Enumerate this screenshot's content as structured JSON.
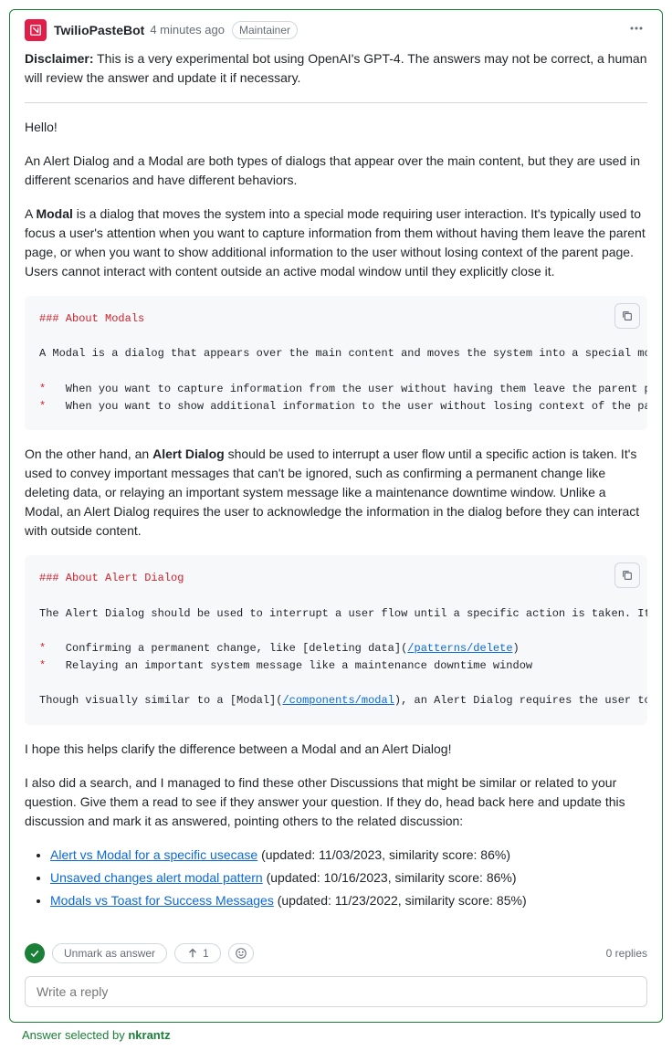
{
  "header": {
    "author": "TwilioPasteBot",
    "timestamp": "4 minutes ago",
    "badge": "Maintainer"
  },
  "body": {
    "disclaimer_label": "Disclaimer:",
    "disclaimer_text": " This is a very experimental bot using OpenAI's GPT-4. The answers may not be correct, a human will review the answer and update it if necessary.",
    "hello": "Hello!",
    "intro": "An Alert Dialog and a Modal are both types of dialogs that appear over the main content, but they are used in different scenarios and have different behaviors.",
    "modal_para_prefix": "A ",
    "modal_bold": "Modal",
    "modal_para_rest": " is a dialog that moves the system into a special mode requiring user interaction. It's typically used to focus a user's attention when you want to capture information from them without having them leave the parent page, or when you want to show additional information to the user without losing context of the parent page. Users cannot interact with content outside an active modal window until they explicitly close it.",
    "alert_para_prefix": "On the other hand, an ",
    "alert_bold": "Alert Dialog",
    "alert_para_rest": " should be used to interrupt a user flow until a specific action is taken. It's used to convey important messages that can't be ignored, such as confirming a permanent change like deleting data, or relaying an important system message like a maintenance downtime window. Unlike a Modal, an Alert Dialog requires the user to acknowledge the information in the dialog before they can interact with outside content.",
    "closing1": "I hope this helps clarify the difference between a Modal and an Alert Dialog!",
    "closing2": "I also did a search, and I managed to find these other Discussions that might be similar or related to your question. Give them a read to see if they answer your question. If they do, head back here and update this discussion and mark it as answered, pointing others to the related discussion:"
  },
  "code1": {
    "heading": "### About Modals",
    "line1": "A Modal is a dialog that appears over the main content and moves the system into a special mode requiring user interaction. It focuses user attention:",
    "bullet": "*",
    "b1": "   When you want to capture information from the user without having them leave the parent page.",
    "b2": "   When you want to show additional information to the user without losing context of the parent page."
  },
  "code2": {
    "heading": "### About Alert Dialog",
    "line1": "The Alert Dialog should be used to interrupt a user flow until a specific action is taken. It is used to convey important messages that can't be ignored:",
    "bullet": "*",
    "b1_pre": "   Confirming a permanent change, like ",
    "b1_link_text": "[deleting data]",
    "b1_link_url": "/patterns/delete",
    "b2": "   Relaying an important system message like a maintenance downtime window",
    "line2_pre": "Though visually similar to a ",
    "line2_link_text": "[Modal]",
    "line2_link_url": "/components/modal",
    "line2_post": ", an Alert Dialog requires the user to acknowledge the information in the dialog before interacting with outside content."
  },
  "related": [
    {
      "title": "Alert vs Modal for a specific usecase",
      "meta": " (updated: 11/03/2023, similarity score: 86%)"
    },
    {
      "title": "Unsaved changes alert modal pattern",
      "meta": " (updated: 10/16/2023, similarity score: 86%)"
    },
    {
      "title": "Modals vs Toast for Success Messages",
      "meta": " (updated: 11/23/2022, similarity score: 85%)"
    }
  ],
  "footer": {
    "unmark": "Unmark as answer",
    "upvote_count": "1",
    "replies": "0 replies",
    "reply_placeholder": "Write a reply",
    "selected_prefix": "Answer selected by ",
    "selected_user": "nkrantz"
  }
}
